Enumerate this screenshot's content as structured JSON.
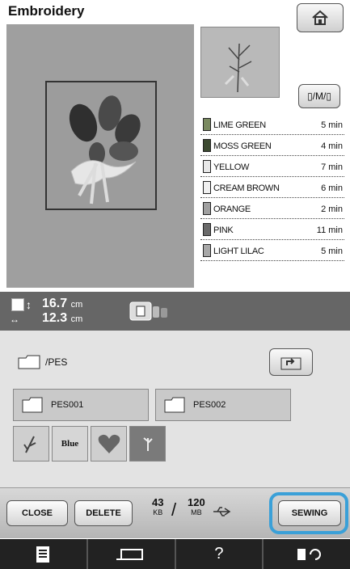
{
  "header": {
    "title": "Embroidery"
  },
  "icons": {
    "home": "home-icon",
    "frame": "frame-display-icon"
  },
  "colors": [
    {
      "name": "LIME GREEN",
      "time": "5 min",
      "swatch": "#7a8a60"
    },
    {
      "name": "MOSS GREEN",
      "time": "4 min",
      "swatch": "#3c4a30"
    },
    {
      "name": "YELLOW",
      "time": "7 min",
      "swatch": "#e8e8e8"
    },
    {
      "name": "CREAM BROWN",
      "time": "6 min",
      "swatch": "#f0f0f0"
    },
    {
      "name": "ORANGE",
      "time": "2 min",
      "swatch": "#a0a0a0"
    },
    {
      "name": "PINK",
      "time": "11 min",
      "swatch": "#6a6a6a"
    },
    {
      "name": "LIGHT LILAC",
      "time": "5 min",
      "swatch": "#a8a8a8"
    }
  ],
  "size": {
    "height": "16.7",
    "width": "12.3",
    "unit": "cm"
  },
  "browser": {
    "path": "/PES",
    "folders": [
      {
        "name": "PES001"
      },
      {
        "name": "PES002"
      }
    ],
    "files": [
      {
        "type": "thumb",
        "label": ""
      },
      {
        "type": "text",
        "label": "Blue"
      },
      {
        "type": "thumb",
        "label": ""
      },
      {
        "type": "thumb",
        "label": ""
      }
    ]
  },
  "footer": {
    "close_label": "CLOSE",
    "delete_label": "DELETE",
    "free_value": "43",
    "free_unit": "KB",
    "total_value": "120",
    "total_unit": "MB",
    "sewing_label": "SEWING"
  },
  "nav": {
    "items": [
      "page-icon",
      "machine-icon",
      "help-icon",
      "settings-icon"
    ],
    "help_label": "?"
  }
}
